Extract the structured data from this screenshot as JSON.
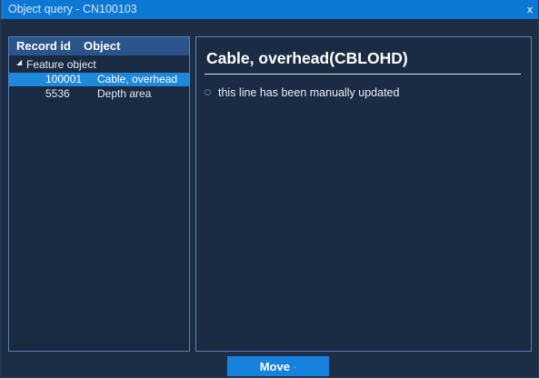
{
  "window": {
    "title": "Object query - CN100103",
    "close_glyph": "x"
  },
  "colors": {
    "titlebar": "#0d78d4",
    "background": "#1c2d45",
    "selected_row": "#1e88dc",
    "panel_border": "#5b81b3",
    "button": "#1782de"
  },
  "tree": {
    "headers": {
      "record_id": "Record id",
      "object": "Object"
    },
    "group": {
      "caret_icon": "caret-down-icon",
      "label": "Feature object"
    },
    "rows": [
      {
        "record_id": "100001",
        "object": "Cable, overhead",
        "selected": true
      },
      {
        "record_id": "5536",
        "object": "Depth area",
        "selected": false
      }
    ]
  },
  "detail": {
    "title": "Cable, overhead(CBLOHD)",
    "notes": [
      {
        "icon": "circle-bullet-icon",
        "text": "this line has been manually updated"
      }
    ]
  },
  "footer": {
    "move_label": "Move",
    "move_suffix": "·"
  }
}
